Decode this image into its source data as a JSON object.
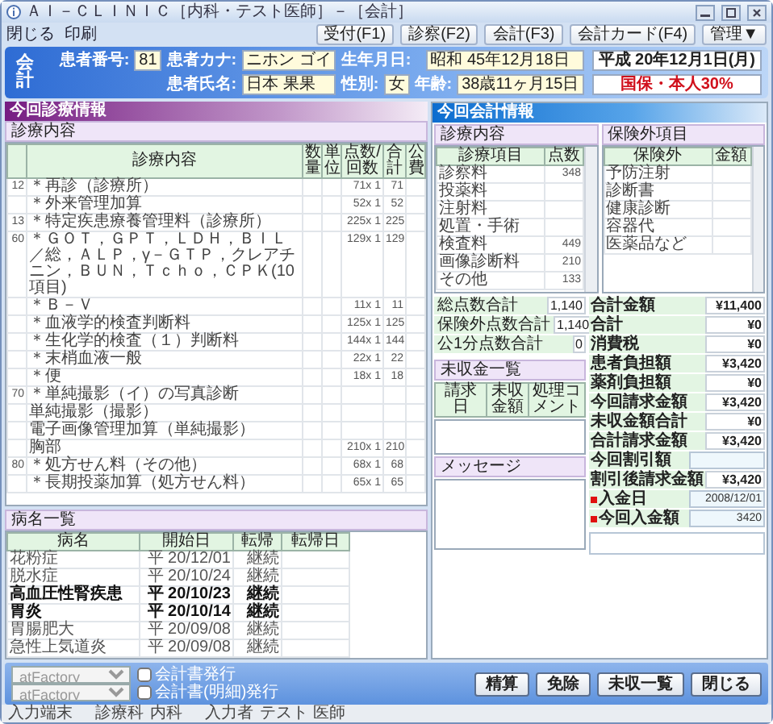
{
  "window": {
    "title": "ＡＩ－ＣＬＩＮＩＣ［内科・テスト医師］－［会計］",
    "toolbar": [
      "受付(F1)",
      "診察(F2)",
      "会計(F3)",
      "会計カード(F4)",
      "管理▼"
    ]
  },
  "menu": [
    "閉じる",
    "印刷"
  ],
  "patient": {
    "title": "会計",
    "fields": [
      {
        "label": "患者番号:",
        "value": "81"
      },
      {
        "label": "患者カナ:",
        "value": "ニホン ゴイ"
      },
      {
        "label": "生年月日:",
        "value": "昭和 45年12月18日"
      },
      {
        "label": "患者氏名:",
        "value": "日本 果果"
      },
      {
        "label": "性別:",
        "value": "女"
      },
      {
        "label": "年齢:",
        "value": "38歳11ヶ月15日"
      }
    ],
    "date": "平成 20年12月1日(月)",
    "insurance": "国保・本人30%"
  },
  "visit": {
    "title": "今回診療情報",
    "subtitle": "診療内容",
    "columns": [
      "診療内容",
      "数量",
      "単位",
      "点数/回数",
      "合計",
      "公費"
    ],
    "rows": [
      {
        "code": "12",
        "item": "＊再診（診療所）",
        "points": "71x 1",
        "total": "71"
      },
      {
        "item": "＊外来管理加算",
        "points": "52x 1",
        "total": "52"
      },
      {
        "code": "13",
        "item": "＊特定疾患療養管理料（診療所）",
        "points": "225x 1",
        "total": "225"
      },
      {
        "code": "60",
        "item": "＊ＧＯＴ，ＧＰＴ，ＬＤＨ，ＢＩＬ／総，ＡＬＰ，γ－ＧＴＰ，クレアチニン，ＢＵＮ，Ｔｃｈｏ，ＣＰＫ(10項目)",
        "points": "129x 1",
        "total": "129"
      },
      {
        "item": "＊Ｂ－Ｖ",
        "points": "11x 1",
        "total": "11"
      },
      {
        "item": "＊血液学的検査判断料",
        "points": "125x 1",
        "total": "125"
      },
      {
        "item": "＊生化学的検査（１）判断料",
        "points": "144x 1",
        "total": "144"
      },
      {
        "item": "＊末梢血液一般",
        "points": "22x 1",
        "total": "22"
      },
      {
        "item": "＊便",
        "points": "18x 1",
        "total": "18"
      },
      {
        "code": "70",
        "item": "＊単純撮影（イ）の写真診断"
      },
      {
        "item": "単純撮影（撮影）"
      },
      {
        "item": "電子画像管理加算（単純撮影）"
      },
      {
        "item": "胸部",
        "points": "210x 1",
        "total": "210"
      },
      {
        "code": "80",
        "item": "＊処方せん料（その他）",
        "points": "68x 1",
        "total": "68"
      },
      {
        "item": "＊長期投薬加算（処方せん料）",
        "points": "65x 1",
        "total": "65"
      }
    ]
  },
  "diseases": {
    "title": "病名一覧",
    "columns": [
      "病名",
      "開始日",
      "転帰",
      "転帰日"
    ],
    "rows": [
      {
        "name": "花粉症",
        "start": "平 20/12/01",
        "outcome": "継続",
        "emphasized": false
      },
      {
        "name": "脱水症",
        "start": "平 20/10/24",
        "outcome": "継続",
        "emphasized": false
      },
      {
        "name": "高血圧性腎疾患",
        "start": "平 20/10/23",
        "outcome": "継続",
        "emphasized": true
      },
      {
        "name": "胃炎",
        "start": "平 20/10/14",
        "outcome": "継続",
        "emphasized": true
      },
      {
        "name": "胃腸肥大",
        "start": "平 20/09/08",
        "outcome": "継続",
        "emphasized": false
      },
      {
        "name": "急性上気道炎",
        "start": "平 20/09/08",
        "outcome": "継続",
        "emphasized": false
      }
    ]
  },
  "billing": {
    "title": "今回会計情報",
    "medical": {
      "subtitle": "診療内容",
      "columns": [
        "診療項目",
        "点数"
      ],
      "rows": [
        {
          "item": "診察料",
          "points": "348"
        },
        {
          "item": "投薬料"
        },
        {
          "item": "注射料"
        },
        {
          "item": "処置・手術"
        },
        {
          "item": "検査料",
          "points": "449"
        },
        {
          "item": "画像診断料",
          "points": "210"
        },
        {
          "item": "その他",
          "points": "133"
        }
      ]
    },
    "extra": {
      "subtitle": "保険外項目",
      "columns": [
        "保険外",
        "金額"
      ],
      "rows": [
        {
          "item": "予防注射"
        },
        {
          "item": "診断書"
        },
        {
          "item": "健康診断"
        },
        {
          "item": "容器代"
        },
        {
          "item": "医薬品など"
        }
      ]
    },
    "point_totals": [
      {
        "label": "総点数合計",
        "value": "1,140"
      },
      {
        "label": "保険外点数合計",
        "value": "1,140"
      },
      {
        "label": "公1分点数合計",
        "value": "0"
      }
    ],
    "unpaid": {
      "title": "未収金一覧",
      "columns": [
        "請求日",
        "未収金額",
        "処理コメント"
      ]
    },
    "message": {
      "title": "メッセージ"
    },
    "amounts": [
      {
        "label": "合計金額",
        "value": "¥11,400",
        "kind": "text"
      },
      {
        "label": "合計",
        "value": "¥0",
        "kind": "text"
      },
      {
        "label": "消費税",
        "value": "¥0",
        "kind": "text"
      },
      {
        "label": "患者負担額",
        "value": "¥3,420",
        "kind": "text"
      },
      {
        "label": "薬剤負担額",
        "value": "¥0",
        "kind": "text"
      },
      {
        "label": "今回請求金額",
        "value": "¥3,420",
        "kind": "text"
      },
      {
        "label": "未収金額合計",
        "value": "¥0",
        "kind": "text"
      },
      {
        "label": "合計請求金額",
        "value": "¥3,420",
        "kind": "text"
      },
      {
        "label": "今回割引額",
        "kind": "input"
      },
      {
        "label": "割引後請求金額",
        "value": "¥3,420",
        "kind": "text"
      },
      {
        "label": "入金日",
        "value": "2008/12/01",
        "kind": "input",
        "required": true
      },
      {
        "label": "今回入金額",
        "value": "3420",
        "kind": "input",
        "required": true
      }
    ]
  },
  "bottom": {
    "printers": [
      "atFactory",
      "atFactory"
    ],
    "options": [
      {
        "label": "会計書発行",
        "checked": false
      },
      {
        "label": "会計書(明細)発行",
        "checked": false
      }
    ],
    "buttons": [
      "精算",
      "免除",
      "未収一覧",
      "閉じる"
    ]
  },
  "status_bar": [
    {
      "label": "入力端末"
    },
    {
      "label": "診療科",
      "value": "内科"
    },
    {
      "label": "入力者",
      "value": "テスト 医師"
    }
  ]
}
